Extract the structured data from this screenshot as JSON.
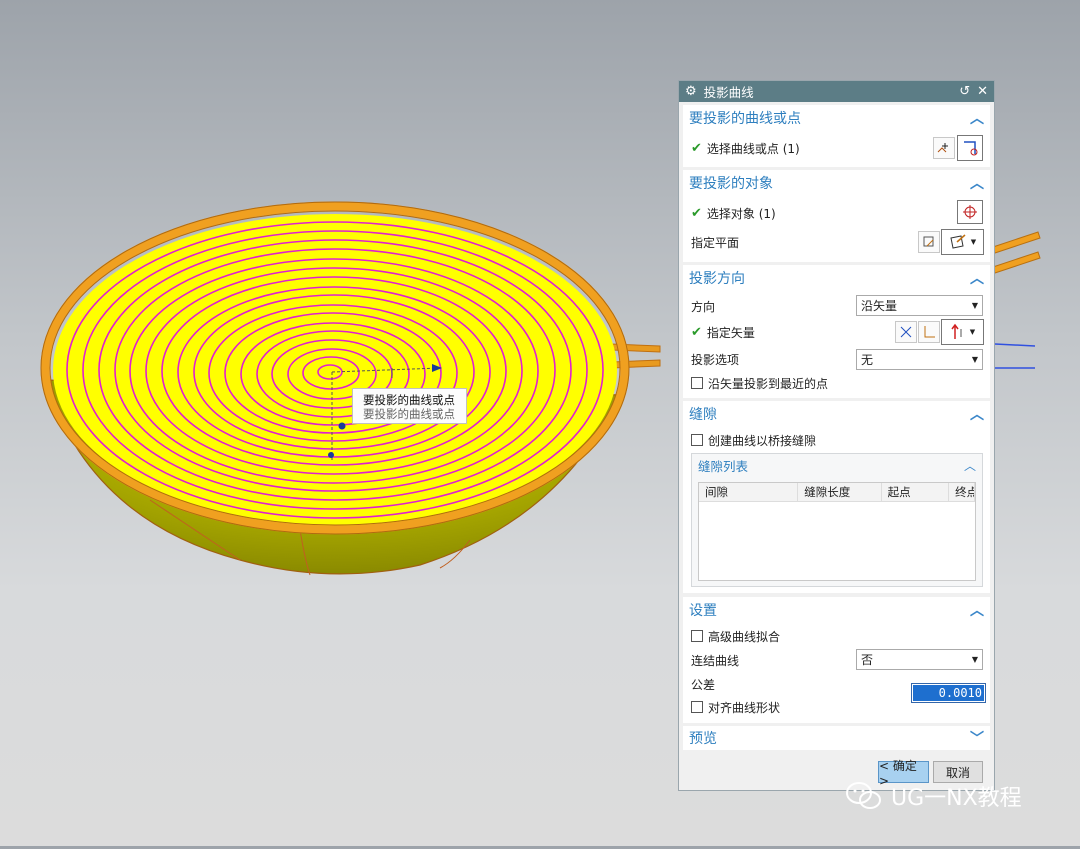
{
  "dialog": {
    "title": "投影曲线",
    "sections": {
      "curves": {
        "title": "要投影的曲线或点",
        "select_label": "选择曲线或点 (1)"
      },
      "objects": {
        "title": "要投影的对象",
        "select_label": "选择对象 (1)",
        "plane_label": "指定平面"
      },
      "direction": {
        "title": "投影方向",
        "direction_label": "方向",
        "direction_value": "沿矢量",
        "vector_label": "指定矢量",
        "option_label": "投影选项",
        "option_value": "无",
        "nearest_label": "沿矢量投影到最近的点"
      },
      "gap": {
        "title": "缝隙",
        "bridge_label": "创建曲线以桥接缝隙",
        "list_title": "缝隙列表",
        "columns": [
          "间隙",
          "缝隙长度",
          "起点",
          "终点"
        ]
      },
      "settings": {
        "title": "设置",
        "advanced_label": "高级曲线拟合",
        "join_label": "连结曲线",
        "join_value": "否",
        "tolerance_label": "公差",
        "tolerance_value": "0.0010",
        "align_label": "对齐曲线形状"
      },
      "preview": {
        "title": "预览"
      }
    },
    "buttons": {
      "ok": "< 确定 >",
      "cancel": "取消"
    }
  },
  "viewport": {
    "tooltip_primary": "要投影的曲线或点",
    "tooltip_secondary": "要投影的曲线或点"
  },
  "watermark": "UG一NX教程",
  "colors": {
    "title_bar": "#5c7d86",
    "section_title": "#2e7fbf",
    "bowl_yellow": "#ffff00",
    "rim_orange": "#f0a020",
    "spiral_magenta": "#e020d0"
  },
  "icons": [
    "gear-icon",
    "reset-icon",
    "close-icon",
    "chevron-up-icon",
    "chevron-down-icon",
    "check-icon",
    "curve-select-icon",
    "point-dialog-icon",
    "crosshair-icon",
    "plane-dialog-icon",
    "vector-icon",
    "wechat-icon"
  ]
}
